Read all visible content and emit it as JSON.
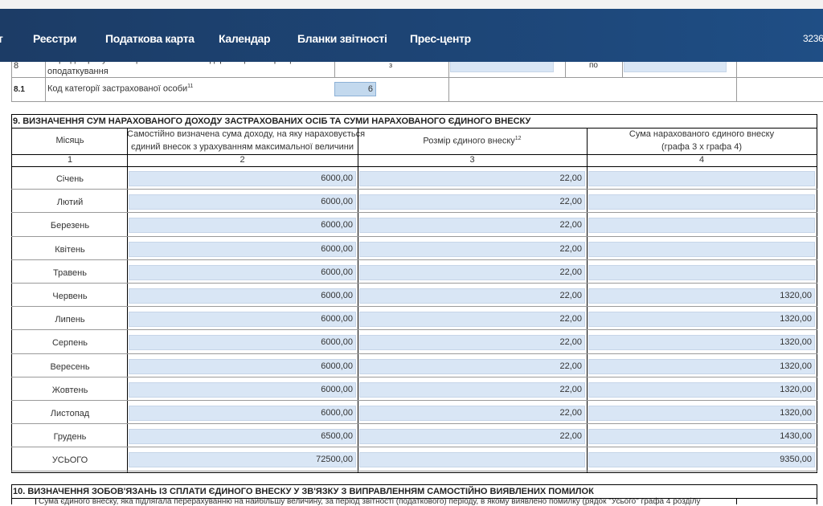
{
  "nav": {
    "items": [
      "т",
      "Реєстри",
      "Податкова карта",
      "Календар",
      "Бланки звітності",
      "Прес-центр",
      "3236"
    ]
  },
  "row8": {
    "number": "8",
    "label_top": "Період перебування фізичної особи - підприємця на спрощеній системі",
    "label_bottom": "оподаткування",
    "from_label": "з",
    "to_label": "по"
  },
  "row81": {
    "number": "8.1",
    "label": "Код категорії застрахованої особи",
    "sup": "11",
    "value": "6"
  },
  "section9": {
    "title": "9. ВИЗНАЧЕННЯ СУМ НАРАХОВАНОГО ДОХОДУ ЗАСТРАХОВАНИХ ОСІБ ТА СУМИ НАРАХОВАНОГО ЄДИНОГО ВНЕСКУ",
    "col1_header": "Місяць",
    "col2_header_1": "Самостійно визначена сума доходу, на яку нараховується",
    "col2_header_2": "єдиний внесок з урахуванням максимальної величини",
    "col3_header": "Розмір єдиного внеску",
    "col3_sup": "12",
    "col4_header_1": "Сума нарахованого єдиного внеску",
    "col4_header_2": "(графа 3 х графа 4)",
    "col_numbers": [
      "1",
      "2",
      "3",
      "4"
    ],
    "rows": [
      {
        "month": "Січень",
        "income": "6000,00",
        "rate": "22,00",
        "amount": ""
      },
      {
        "month": "Лютий",
        "income": "6000,00",
        "rate": "22,00",
        "amount": ""
      },
      {
        "month": "Березень",
        "income": "6000,00",
        "rate": "22,00",
        "amount": ""
      },
      {
        "month": "Квітень",
        "income": "6000,00",
        "rate": "22,00",
        "amount": ""
      },
      {
        "month": "Травень",
        "income": "6000,00",
        "rate": "22,00",
        "amount": ""
      },
      {
        "month": "Червень",
        "income": "6000,00",
        "rate": "22,00",
        "amount": "1320,00"
      },
      {
        "month": "Липень",
        "income": "6000,00",
        "rate": "22,00",
        "amount": "1320,00"
      },
      {
        "month": "Серпень",
        "income": "6000,00",
        "rate": "22,00",
        "amount": "1320,00"
      },
      {
        "month": "Вересень",
        "income": "6000,00",
        "rate": "22,00",
        "amount": "1320,00"
      },
      {
        "month": "Жовтень",
        "income": "6000,00",
        "rate": "22,00",
        "amount": "1320,00"
      },
      {
        "month": "Листопад",
        "income": "6000,00",
        "rate": "22,00",
        "amount": "1320,00"
      },
      {
        "month": "Грудень",
        "income": "6500,00",
        "rate": "22,00",
        "amount": "1430,00"
      }
    ],
    "total": {
      "label": "УСЬОГО",
      "income": "72500,00",
      "rate": "",
      "amount": "9350,00"
    }
  },
  "section10": {
    "title": "10. ВИЗНАЧЕННЯ ЗОБОВ'ЯЗАНЬ ІЗ СПЛАТИ ЄДИНОГО ВНЕСКУ У ЗВ'ЯЗКУ З ВИПРАВЛЕННЯМ САМОСТІЙНО ВИЯВЛЕНИХ ПОМИЛОК",
    "partial_text": "Сума єдиного внеску, яка підлягала перерахуванню на найбільшу величину, за період звітності (податкового) періоду, в якому виявлено помилку (рядок \"Усього\" графа 4 розділу"
  },
  "colors": {
    "navbar": "#1d4576",
    "input": "#d9e6f5",
    "input_active": "#c3d9ee"
  }
}
